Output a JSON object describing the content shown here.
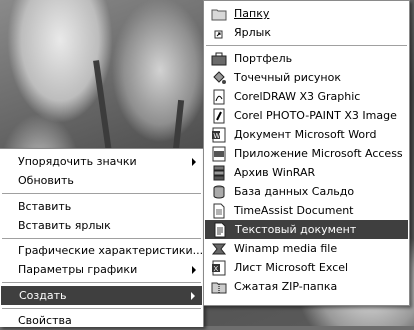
{
  "context_menu": {
    "items": [
      {
        "label": "Упорядочить значки",
        "has_submenu": true
      },
      {
        "label": "Обновить",
        "has_submenu": false
      },
      {
        "label": "Вставить",
        "has_submenu": false
      },
      {
        "label": "Вставить ярлык",
        "has_submenu": false
      },
      {
        "label": "Графические характеристики...",
        "has_submenu": false
      },
      {
        "label": "Параметры графики",
        "has_submenu": true
      },
      {
        "label": "Создать",
        "has_submenu": true,
        "highlighted": true
      },
      {
        "label": "Свойства",
        "has_submenu": false
      }
    ]
  },
  "new_submenu": {
    "items": [
      {
        "label": "Папку",
        "icon": "folder-icon"
      },
      {
        "label": "Ярлык",
        "icon": "shortcut-icon"
      },
      {
        "label": "Портфель",
        "icon": "briefcase-icon"
      },
      {
        "label": "Точечный рисунок",
        "icon": "paint-bucket-icon"
      },
      {
        "label": "CorelDRAW X3 Graphic",
        "icon": "coreldraw-icon"
      },
      {
        "label": "Corel PHOTO-PAINT X3 Image",
        "icon": "photopaint-icon"
      },
      {
        "label": "Документ Microsoft Word",
        "icon": "word-icon"
      },
      {
        "label": "Приложение Microsoft Access",
        "icon": "access-icon"
      },
      {
        "label": "Архив WinRAR",
        "icon": "winrar-icon"
      },
      {
        "label": "База данных Сальдо",
        "icon": "database-icon"
      },
      {
        "label": "TimeAssist Document",
        "icon": "document-icon"
      },
      {
        "label": "Текстовый документ",
        "icon": "text-document-icon",
        "highlighted": true
      },
      {
        "label": "Winamp media file",
        "icon": "winamp-icon"
      },
      {
        "label": "Лист Microsoft Excel",
        "icon": "excel-icon"
      },
      {
        "label": "Сжатая ZIP-папка",
        "icon": "zip-folder-icon"
      }
    ]
  },
  "colors": {
    "highlight": "#3f3f3f",
    "menu_bg": "#ffffff"
  }
}
